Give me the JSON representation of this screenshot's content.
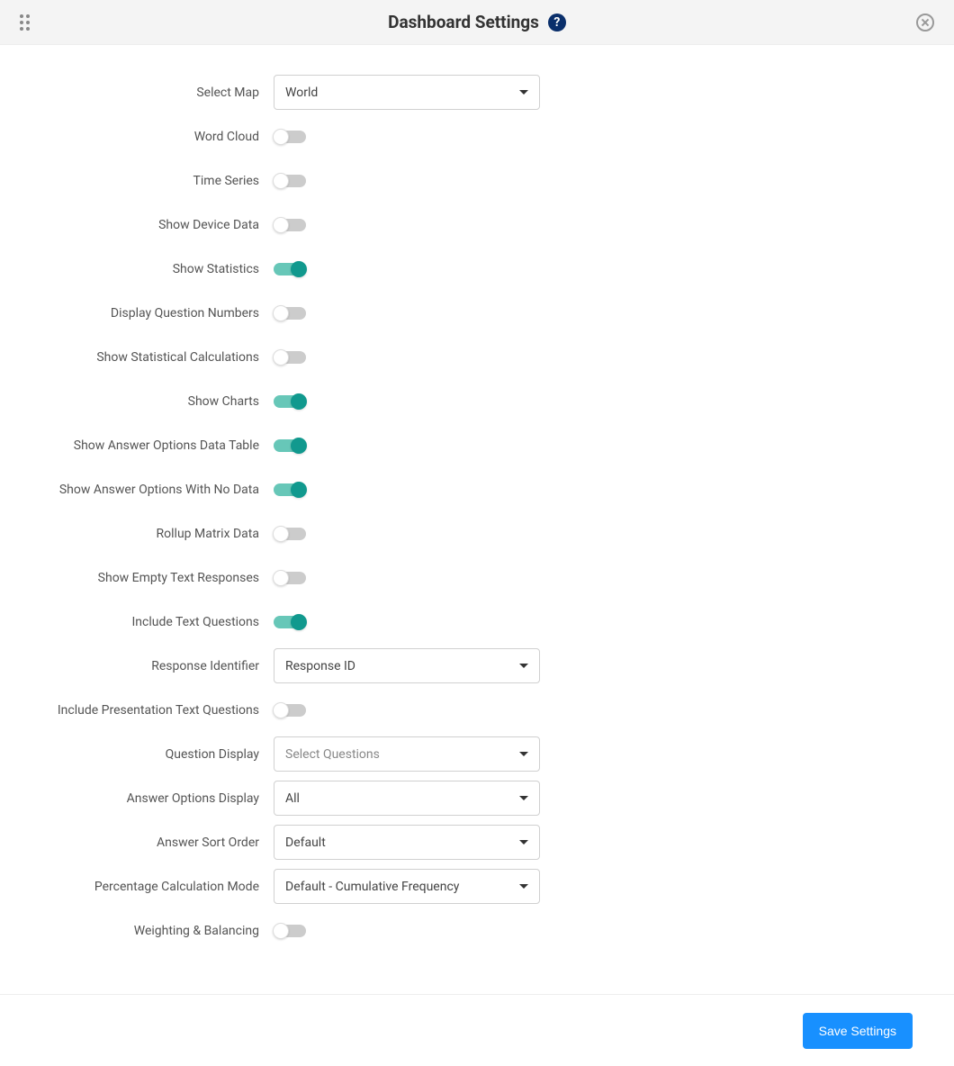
{
  "header": {
    "title": "Dashboard Settings"
  },
  "fields": [
    {
      "type": "select",
      "label": "Select Map",
      "value": "World",
      "placeholder": false
    },
    {
      "type": "toggle",
      "label": "Word Cloud",
      "on": false
    },
    {
      "type": "toggle",
      "label": "Time Series",
      "on": false
    },
    {
      "type": "toggle",
      "label": "Show Device Data",
      "on": false
    },
    {
      "type": "toggle",
      "label": "Show Statistics",
      "on": true
    },
    {
      "type": "toggle",
      "label": "Display Question Numbers",
      "on": false
    },
    {
      "type": "toggle",
      "label": "Show Statistical Calculations",
      "on": false
    },
    {
      "type": "toggle",
      "label": "Show Charts",
      "on": true
    },
    {
      "type": "toggle",
      "label": "Show Answer Options Data Table",
      "on": true
    },
    {
      "type": "toggle",
      "label": "Show Answer Options With No Data",
      "on": true
    },
    {
      "type": "toggle",
      "label": "Rollup Matrix Data",
      "on": false
    },
    {
      "type": "toggle",
      "label": "Show Empty Text Responses",
      "on": false
    },
    {
      "type": "toggle",
      "label": "Include Text Questions",
      "on": true
    },
    {
      "type": "select",
      "label": "Response Identifier",
      "value": "Response ID",
      "placeholder": false
    },
    {
      "type": "toggle",
      "label": "Include Presentation Text Questions",
      "on": false
    },
    {
      "type": "select",
      "label": "Question Display",
      "value": "Select Questions",
      "placeholder": true
    },
    {
      "type": "select",
      "label": "Answer Options Display",
      "value": "All",
      "placeholder": false
    },
    {
      "type": "select",
      "label": "Answer Sort Order",
      "value": "Default",
      "placeholder": false
    },
    {
      "type": "select",
      "label": "Percentage Calculation Mode",
      "value": "Default - Cumulative Frequency",
      "placeholder": false
    },
    {
      "type": "toggle",
      "label": "Weighting & Balancing",
      "on": false
    }
  ],
  "footer": {
    "save_label": "Save Settings"
  }
}
